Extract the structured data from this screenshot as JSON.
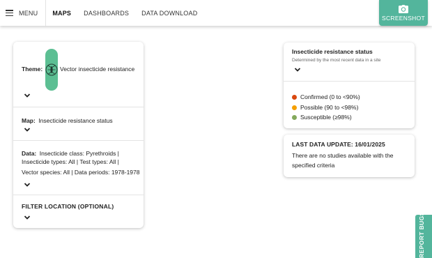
{
  "nav": {
    "menu_label": "MENU",
    "items": [
      {
        "label": "MAPS",
        "active": true
      },
      {
        "label": "DASHBOARDS",
        "active": false
      },
      {
        "label": "DATA DOWNLOAD",
        "active": false
      }
    ],
    "screenshot_label": "SCREENSHOT"
  },
  "panel": {
    "theme": {
      "label": "Theme:",
      "value": "Vector insecticide resistance",
      "icon": "mosquito-icon"
    },
    "map": {
      "label": "Map:",
      "value": "Insecticide resistance status"
    },
    "data": {
      "label": "Data:",
      "line1": "Insecticide class: Pyrethroids |",
      "line2": "Insecticide types: All | Test types: All |",
      "line3": "Vector species: All | Data periods: 1978-1978"
    },
    "filter": {
      "label": "FILTER LOCATION (OPTIONAL)"
    }
  },
  "legend": {
    "title": "Insecticide resistance status",
    "subtitle": "Determined by the most recent data in a site",
    "items": [
      {
        "label": "Confirmed (0 to <90%)",
        "color": "#d9480f"
      },
      {
        "label": "Possible (90 to <98%)",
        "color": "#f59f00"
      },
      {
        "label": "Susceptible (≥98%)",
        "color": "#84a95c"
      }
    ]
  },
  "update": {
    "title": "LAST DATA UPDATE: 16/01/2025",
    "message_line1": "There are no studies available with the",
    "message_line2": "specified criteria"
  },
  "report_bugs_label": "REPORT BUGS",
  "colors": {
    "accent": "#53b59c",
    "theme_icon_bg": "#5cbf93"
  }
}
